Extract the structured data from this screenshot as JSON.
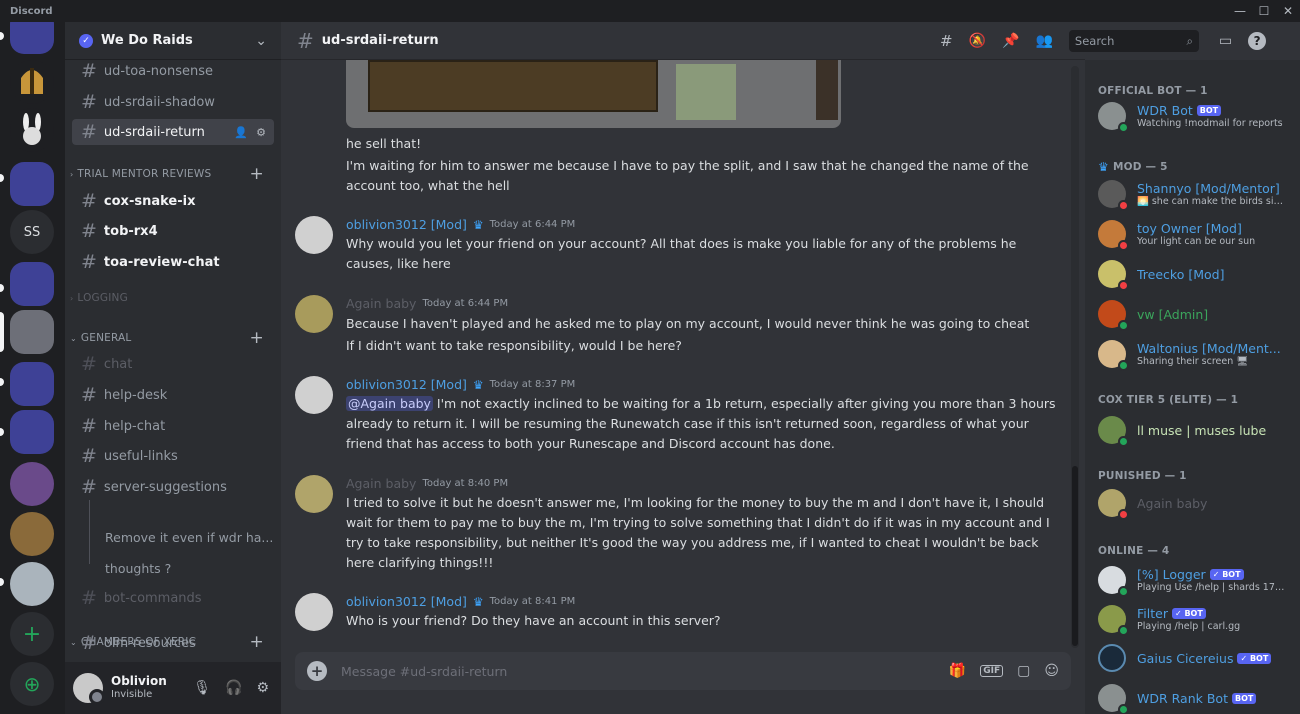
{
  "app": {
    "title": "Discord",
    "winctl": [
      "—",
      "☐",
      "✕"
    ]
  },
  "guild": {
    "name": "We Do Raids",
    "verified_icon": "✓",
    "chevron": "⌄"
  },
  "rail": {
    "dm_label": "SS",
    "add_label": "+",
    "explore_label": "⊕"
  },
  "sidebar": {
    "channels_top": [
      {
        "name": "ud-toa-nonsense",
        "state": "normal"
      },
      {
        "name": "ud-srdaii-shadow",
        "state": "normal"
      },
      {
        "name": "ud-srdaii-return",
        "state": "active"
      }
    ],
    "cat_trial": "TRIAL MENTOR REVIEWS",
    "channels_trial": [
      {
        "name": "cox-snake-ix"
      },
      {
        "name": "tob-rx4"
      },
      {
        "name": "toa-review-chat"
      }
    ],
    "cat_logging": "LOGGING",
    "cat_general": "GENERAL",
    "channels_general": [
      {
        "name": "chat",
        "state": "muted"
      },
      {
        "name": "help-desk",
        "state": "normal"
      },
      {
        "name": "help-chat",
        "state": "normal"
      },
      {
        "name": "useful-links",
        "state": "normal"
      },
      {
        "name": "server-suggestions",
        "state": "normal"
      }
    ],
    "threads": [
      "Remove it even if wdr ha...",
      "thoughts ?"
    ],
    "bot_commands": "bot-commands",
    "cat_cox": "CHAMBERS OF XERIC",
    "olm": "olm-resources"
  },
  "user": {
    "name": "Oblivion",
    "status": "Invisible"
  },
  "channel": {
    "name": "ud-srdaii-return"
  },
  "header": {
    "search_placeholder": "Search"
  },
  "messages": {
    "m0": {
      "lines": [
        "he sell that!",
        "I'm waiting for him to answer me because I have to pay the split, and I saw that he changed the name of the account too, what the hell"
      ]
    },
    "m1": {
      "author": "oblivion3012 [Mod]",
      "time": "Today at 6:44 PM",
      "text": "Why would you let your friend on your account? All that does is make you liable for any of the problems he causes, like here"
    },
    "m2": {
      "author": "Again baby",
      "time": "Today at 6:44 PM",
      "l1": "Because I haven't played and he asked me to play on my account, I would never think he was going to cheat",
      "l2": "If I didn't want to take responsibility, would I be here?"
    },
    "m3": {
      "author": "oblivion3012 [Mod]",
      "time": "Today at 8:37 PM",
      "mention": "@Again baby",
      "text": " I'm not exactly inclined to be waiting for a 1b return, especially after giving you more than 3 hours already to return it. I will be resuming the Runewatch case if this isn't returned soon, regardless of what your friend that has access to both your Runescape and Discord account has done."
    },
    "m4": {
      "author": "Again baby",
      "time": "Today at 8:40 PM",
      "text": "I tried to solve it but he doesn't answer me, I'm looking for the money to buy the m and I don't have it, I should wait for them to pay me to buy the m, I'm trying to solve something that I didn't do if it was in my account and I try to take responsibility, but neither It's good the way you address me, if I wanted to cheat I wouldn't be back here clarifying things!!!"
    },
    "m5": {
      "author": "oblivion3012 [Mod]",
      "time": "Today at 8:41 PM",
      "text": "Who is your friend? Do they have an account in this server?"
    }
  },
  "composer": {
    "placeholder": "Message #ud-srdaii-return",
    "gif": "GIF"
  },
  "members": {
    "c1": "OFFICIAL BOT — 1",
    "c2": "MOD — 5",
    "c3": "COX TIER 5 (ELITE) — 1",
    "c4": "PUNISHED — 1",
    "c5": "ONLINE — 4",
    "bot_tag": "BOT",
    "bot_check": "✓ BOT",
    "wdr": {
      "name": "WDR Bot",
      "activity": "Watching !modmail for reports"
    },
    "shannyo": {
      "name": "Shannyo [Mod/Mentor]",
      "activity": "🌅 she can make the birds sin..."
    },
    "toy": {
      "name": "toy Owner [Mod]",
      "activity": "Your light can be our sun"
    },
    "treecko": {
      "name": "Treecko [Mod]"
    },
    "vw": {
      "name": "vw [Admin]"
    },
    "walt": {
      "name": "Waltonius [Mod/Ment...",
      "activity": "Sharing their screen 🖥"
    },
    "muse": {
      "name": "ll muse | muses lube"
    },
    "again": {
      "name": "Again baby"
    },
    "logger": {
      "name": "[%] Logger",
      "activity": "Playing Use /help | shards 176..."
    },
    "filter": {
      "name": "Filter",
      "activity": "Playing /help | carl.gg"
    },
    "gaius": {
      "name": "Gaius Cicereius"
    },
    "rank": {
      "name": "WDR Rank Bot"
    }
  },
  "colors": {
    "mod_blue": "#4e9fe2",
    "online": "#23a55a",
    "dnd": "#f23f43",
    "brand": "#5865f2"
  }
}
